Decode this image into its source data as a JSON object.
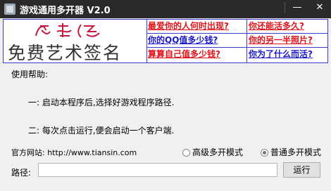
{
  "window": {
    "title": "游戏通用多开器 V2.0",
    "minimize_glyph": "—",
    "close_glyph": "✕"
  },
  "banner": {
    "logo_text": "免费艺术签名",
    "links": [
      {
        "label": "最爱你的人何时出现?",
        "color": "#e0141a"
      },
      {
        "label": "你还能活多久?",
        "color": "#e0141a"
      },
      {
        "label": "你的QQ值多少钱?",
        "color": "#1a1acc"
      },
      {
        "label": "你的另一半照片?",
        "color": "#e0141a"
      },
      {
        "label": "算算自己值多少钱?",
        "color": "#e0141a"
      },
      {
        "label": "你为了什么而活?",
        "color": "#1a1acc"
      }
    ]
  },
  "help": {
    "title": "使用帮助:",
    "step1": "一: 启动本程序后,选择好游戏程序路径.",
    "step2": "二: 每次点击运行,便会启动一个客户端."
  },
  "site": {
    "text": "官方网站: http://www.tiansin.com"
  },
  "mode": {
    "advanced_label": "高级多开模式",
    "normal_label": "普通多开模式",
    "selected": "normal"
  },
  "path": {
    "label": "路径:",
    "value": "",
    "run_label": "运行"
  }
}
